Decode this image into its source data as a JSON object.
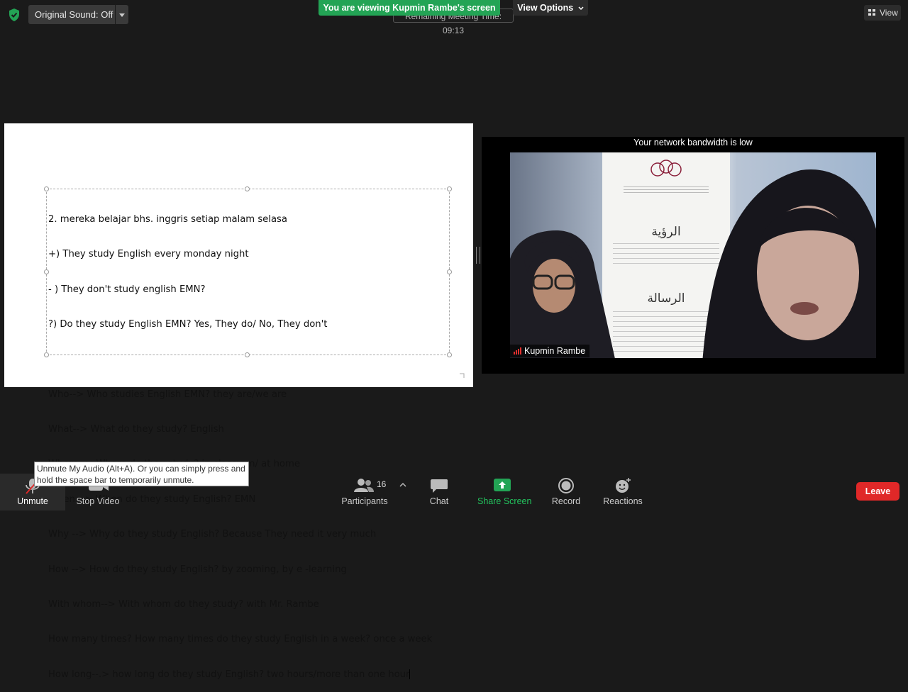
{
  "top_bar": {
    "security_icon": "shield-check-icon",
    "original_sound_label": "Original Sound: Off",
    "meeting_time_text": "Remaining Meeting Time: 09:13",
    "viewing_banner": "You are viewing Kupmin Rambe's screen",
    "view_options_label": "View Options",
    "view_label": "View"
  },
  "shared_slide": {
    "lines": [
      "2. mereka belajar bhs. inggris setiap malam selasa",
      "+) They study English every monday night",
      "- ) They don't study english EMN?",
      "?) Do they study English EMN? Yes, They do/ No, They don't",
      "",
      "Who--> Who studies English EMN? they are/we are",
      "What--> What do they study? English",
      "Where--> Where do they study? in classrom/ at home",
      "When --> When do they study English? EMN",
      "Why --> Why do they study English? Because They need it very much",
      "How --> How do they study English? by zooming, by e -learning",
      "With whom--> With whom do they study? with Mr. Rambe",
      "How many times? How many times do they study English in a week? once a week",
      "How long--.> how long do they study English? two hours/more than one hour"
    ]
  },
  "video": {
    "bandwidth_warning": "Your network bandwidth is low",
    "participant_name": "Kupmin Rambe",
    "poster_heading_1": "الرؤية",
    "poster_heading_2": "الرسالة"
  },
  "toolbar": {
    "unmute_label": "Unmute",
    "stop_video_label": "Stop Video",
    "participants_label": "Participants",
    "participants_count": "16",
    "chat_label": "Chat",
    "share_screen_label": "Share Screen",
    "record_label": "Record",
    "reactions_label": "Reactions",
    "leave_label": "Leave",
    "tooltip": "Unmute My Audio (Alt+A). Or you can simply press and hold the space bar to temporarily unmute."
  },
  "colors": {
    "share_green": "#23a455",
    "leave_red": "#e02828",
    "background": "#1a1a1a"
  }
}
